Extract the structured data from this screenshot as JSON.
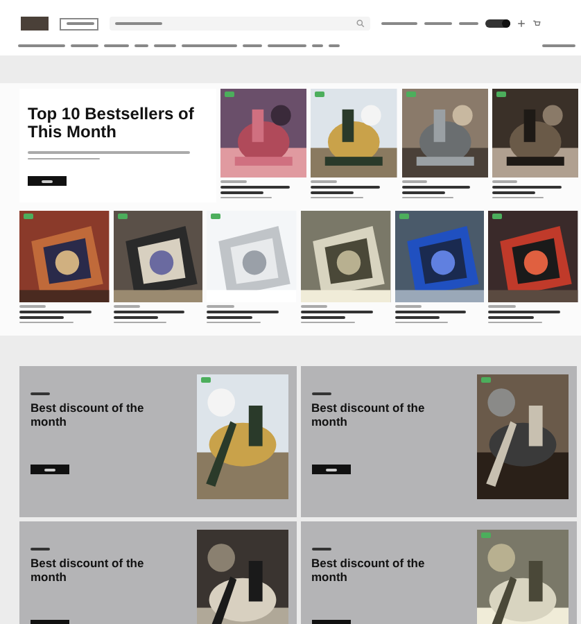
{
  "header": {
    "toggle": {
      "on": true
    }
  },
  "hero": {
    "title": "Top 10 Bestsellers of This Month"
  },
  "top_products": [
    {
      "badge": true
    },
    {
      "badge": true
    },
    {
      "badge": true
    },
    {
      "badge": true
    }
  ],
  "more_products": [
    {
      "badge": true
    },
    {
      "badge": true
    },
    {
      "badge": true
    },
    {
      "badge": false
    },
    {
      "badge": true
    },
    {
      "badge": true
    }
  ],
  "promos": [
    {
      "title": "Best discount of the month",
      "badge": true
    },
    {
      "title": "Best discount of the month",
      "badge": true
    },
    {
      "title": "Best discount of the month",
      "badge": false
    },
    {
      "title": "Best discount of the month",
      "badge": true
    }
  ]
}
